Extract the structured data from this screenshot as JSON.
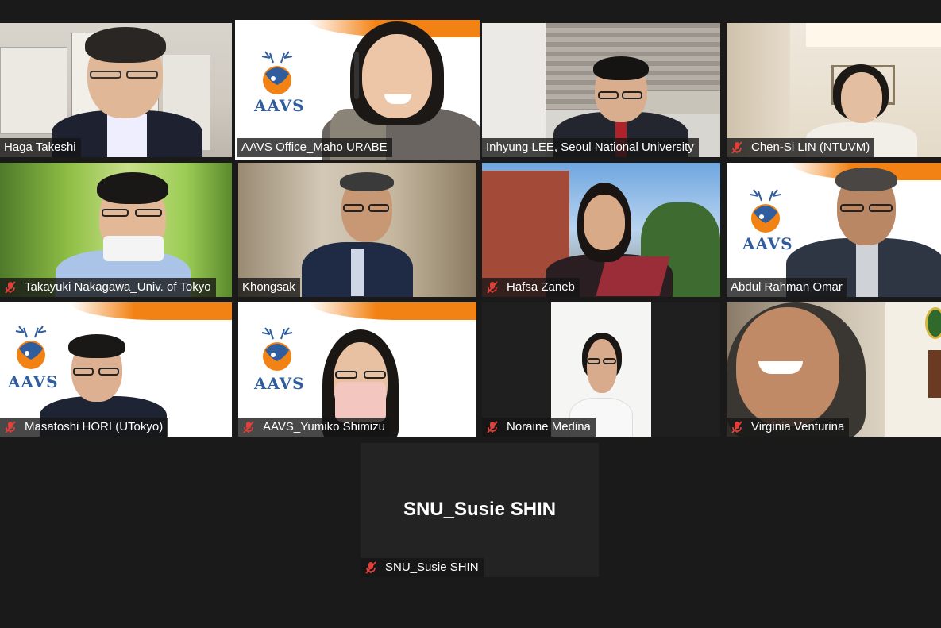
{
  "meeting": {
    "participants": [
      {
        "name": "Haga Takeshi",
        "muted": false
      },
      {
        "name": "AAVS Office_Maho URABE",
        "muted": false,
        "active_speaker": true
      },
      {
        "name": "Inhyung LEE, Seoul National University",
        "muted": false
      },
      {
        "name": "Chen-Si LIN (NTUVM)",
        "muted": true
      },
      {
        "name": "Takayuki Nakagawa_Univ. of Tokyo",
        "muted": true
      },
      {
        "name": "Khongsak",
        "muted": false
      },
      {
        "name": "Hafsa Zaneb",
        "muted": true
      },
      {
        "name": "Abdul Rahman Omar",
        "muted": false
      },
      {
        "name": "Masatoshi HORI (UTokyo)",
        "muted": true
      },
      {
        "name": "AAVS_Yumiko Shimizu",
        "muted": true
      },
      {
        "name": "Noraine Medina",
        "muted": true
      },
      {
        "name": "Virginia Venturina",
        "muted": true
      },
      {
        "name": "SNU_Susie SHIN",
        "muted": true,
        "video_off": true
      }
    ],
    "video_off_display_name": "SNU_Susie SHIN",
    "logo_text": "AAVS"
  },
  "colors": {
    "background": "#1a1a1a",
    "active_speaker_border": "#d8e85a",
    "muted_icon": "#e0403a",
    "aavs_orange": "#f28214",
    "aavs_blue": "#2f5d9e"
  }
}
